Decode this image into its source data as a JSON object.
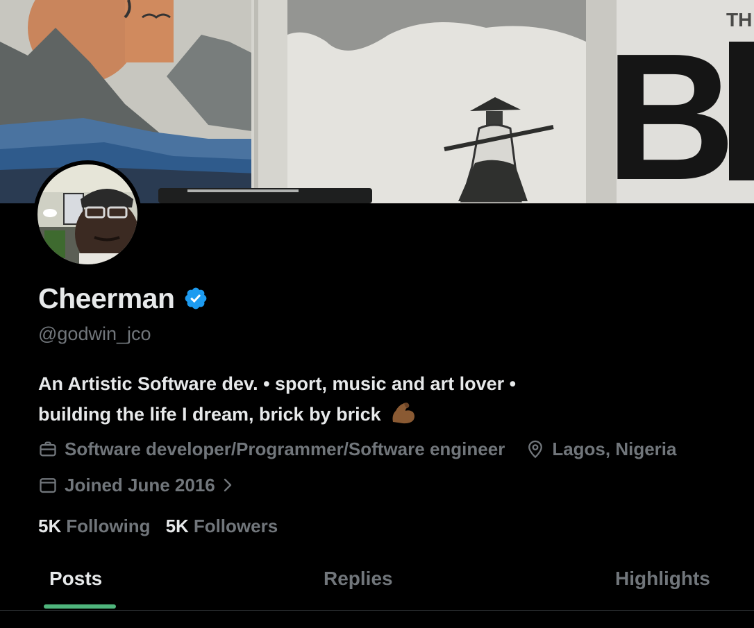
{
  "profile": {
    "display_name": "Cheerman",
    "handle": "@godwin_jco",
    "bio_line1": "An Artistic Software dev. • sport, music and art lover •",
    "bio_line2": "building the life I dream, brick by brick",
    "bio_emoji": "flexed-biceps-icon",
    "profession": "Software developer/Programmer/Software engineer",
    "location": "Lagos, Nigeria",
    "joined": "Joined June 2016",
    "following_count": "5K",
    "following_label": "Following",
    "followers_count": "5K",
    "followers_label": "Followers",
    "verified": true
  },
  "banner": {
    "visible_letters_top": "TH",
    "visible_letters_big": "B"
  },
  "tabs": [
    {
      "label": "Posts",
      "active": true
    },
    {
      "label": "Replies",
      "active": false
    },
    {
      "label": "Highlights",
      "active": false
    }
  ],
  "colors": {
    "background": "#000000",
    "primary_text": "#e7e9ea",
    "secondary_text": "#71767b",
    "verified_blue": "#1d9bf0",
    "tab_indicator": "#4fb57c"
  }
}
